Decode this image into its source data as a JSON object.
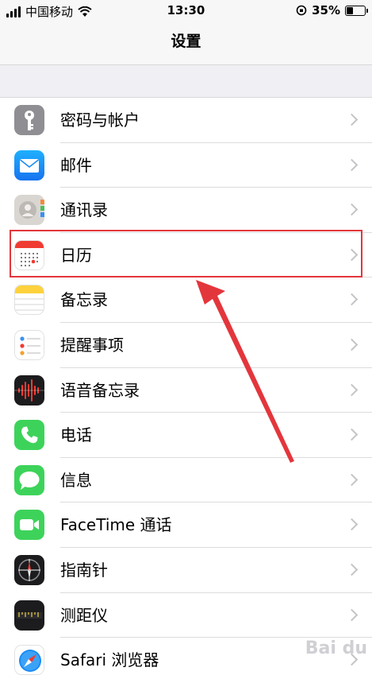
{
  "status_bar": {
    "carrier": "中国移动",
    "time": "13:30",
    "battery_percent": "35%",
    "battery_level": 0.35
  },
  "nav": {
    "title": "设置"
  },
  "settings_items": [
    {
      "label": "密码与帐户",
      "icon": "key-icon"
    },
    {
      "label": "邮件",
      "icon": "mail-icon"
    },
    {
      "label": "通讯录",
      "icon": "contacts-icon"
    },
    {
      "label": "日历",
      "icon": "calendar-icon"
    },
    {
      "label": "备忘录",
      "icon": "notes-icon"
    },
    {
      "label": "提醒事项",
      "icon": "reminders-icon"
    },
    {
      "label": "语音备忘录",
      "icon": "voice-memos-icon"
    },
    {
      "label": "电话",
      "icon": "phone-icon"
    },
    {
      "label": "信息",
      "icon": "messages-icon"
    },
    {
      "label": "FaceTime 通话",
      "icon": "facetime-icon"
    },
    {
      "label": "指南针",
      "icon": "compass-icon"
    },
    {
      "label": "测距仪",
      "icon": "measure-icon"
    },
    {
      "label": "Safari 浏览器",
      "icon": "safari-icon"
    }
  ],
  "colors": {
    "annotation_red": "#e3363c"
  }
}
